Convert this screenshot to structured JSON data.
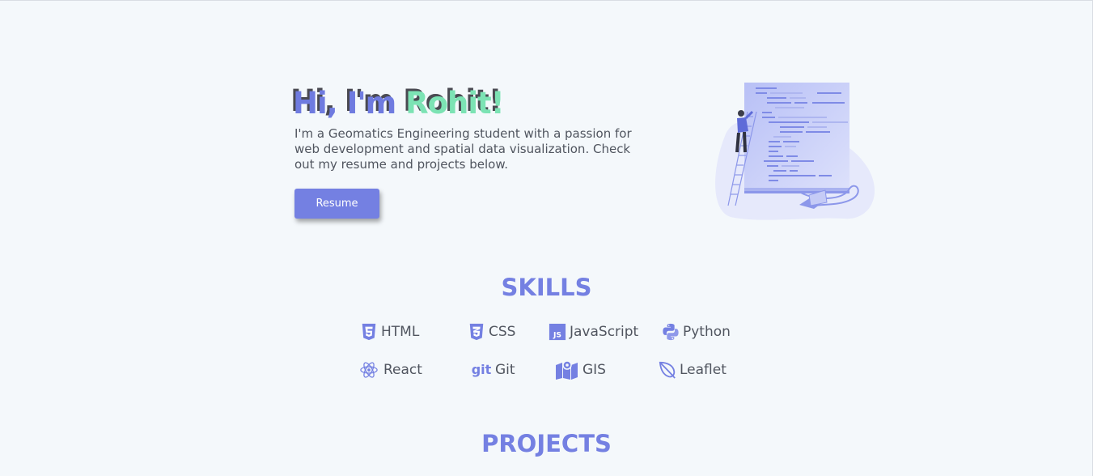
{
  "hero": {
    "greeting": "Hi, I'm ",
    "name": "Rohit!",
    "description": "I'm a Geomatics Engineering student with a passion for web development and spatial data visualization. Check out my resume and projects below.",
    "resume_label": "Resume"
  },
  "skills": {
    "title": "SKILLS",
    "items": [
      {
        "label": "HTML",
        "icon": "html5-icon"
      },
      {
        "label": "CSS",
        "icon": "css3-icon"
      },
      {
        "label": "JavaScript",
        "icon": "javascript-icon"
      },
      {
        "label": "Python",
        "icon": "python-icon"
      },
      {
        "label": "React",
        "icon": "react-icon"
      },
      {
        "label": "Git",
        "icon": "git-icon"
      },
      {
        "label": "GIS",
        "icon": "map-icon"
      },
      {
        "label": "Leaflet",
        "icon": "leaf-icon"
      }
    ]
  },
  "projects": {
    "title": "PROJECTS"
  },
  "colors": {
    "accent": "#7480e2",
    "name_highlight": "#7ce3b4",
    "background": "#f4f8fb",
    "text": "#50555f"
  }
}
